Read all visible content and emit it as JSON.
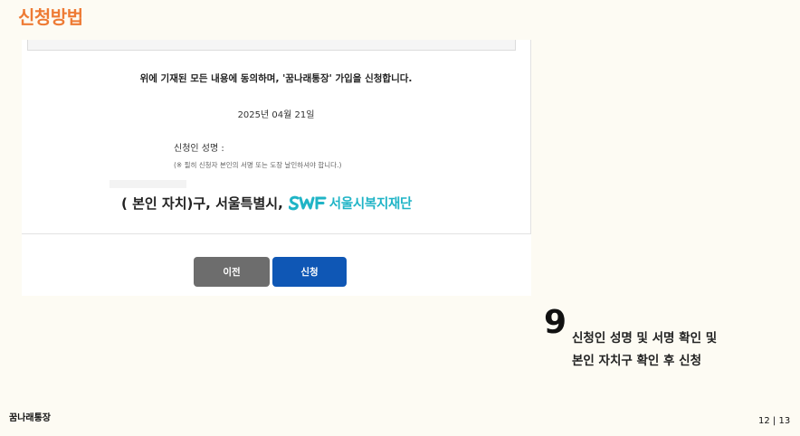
{
  "page": {
    "section_title": "신청방법",
    "footer_brand": "꿈나래통장",
    "page_number": "12 | 13"
  },
  "form": {
    "agree_text": "위에 기재된 모든 내용에 동의하며, '꿈나래통장' 가입을 신청합니다.",
    "date": "2025년 04월 21일",
    "signer_label": "신청인 성명 :",
    "note": "(※ 필히 신청자 본인의 서명 또는 도장 날인하셔야 합니다.)",
    "district_text": "(   본인 자치)구, 서울특별시,",
    "foundation_name": "서울시복지재단",
    "logo_icon": "swf-logo-icon",
    "logo_color": "#1fb4c6"
  },
  "buttons": {
    "prev_label": "이전",
    "apply_label": "신청",
    "prev_color": "#6d6d6d",
    "apply_color": "#0f57b5"
  },
  "step": {
    "number": "9",
    "line1": "신청인 성명 및 서명 확인 및",
    "line2": "본인 자치구 확인 후 신청"
  },
  "colors": {
    "accent": "#ee7b35",
    "background": "#fdfbf3"
  }
}
